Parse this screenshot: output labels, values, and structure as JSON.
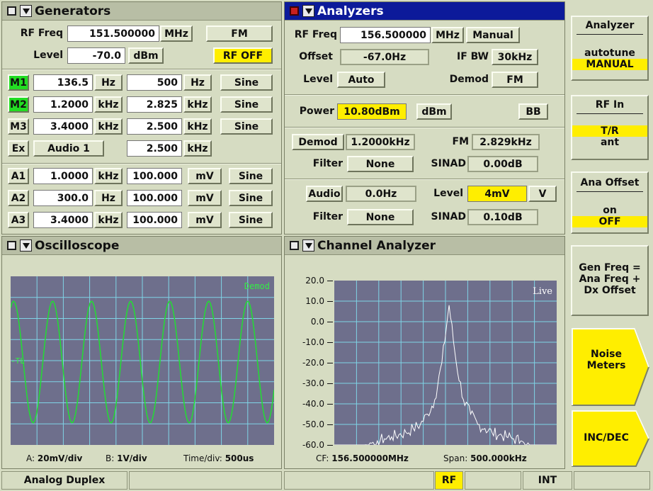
{
  "generators": {
    "title": "Generators",
    "rf_freq_label": "RF Freq",
    "rf_freq": "151.500000",
    "rf_freq_unit": "MHz",
    "mode": "FM",
    "level_label": "Level",
    "level": "-70.0",
    "level_unit": "dBm",
    "rf_state": "RF OFF",
    "mod_rows": [
      {
        "name": "M1",
        "freq": "136.5",
        "freq_unit": "Hz",
        "dev": "500",
        "dev_unit": "Hz",
        "wave": "Sine",
        "active": true
      },
      {
        "name": "M2",
        "freq": "1.2000",
        "freq_unit": "kHz",
        "dev": "2.825",
        "dev_unit": "kHz",
        "wave": "Sine",
        "active": true
      },
      {
        "name": "M3",
        "freq": "3.4000",
        "freq_unit": "kHz",
        "dev": "2.500",
        "dev_unit": "kHz",
        "wave": "Sine",
        "active": false
      }
    ],
    "ex": {
      "name": "Ex",
      "source": "Audio 1",
      "dev": "2.500",
      "dev_unit": "kHz"
    },
    "audio_rows": [
      {
        "name": "A1",
        "freq": "1.0000",
        "freq_unit": "kHz",
        "level": "100.000",
        "level_unit": "mV",
        "wave": "Sine"
      },
      {
        "name": "A2",
        "freq": "300.0",
        "freq_unit": "Hz",
        "level": "100.000",
        "level_unit": "mV",
        "wave": "Sine"
      },
      {
        "name": "A3",
        "freq": "3.4000",
        "freq_unit": "kHz",
        "level": "100.000",
        "level_unit": "mV",
        "wave": "Sine"
      }
    ]
  },
  "analyzers": {
    "title": "Analyzers",
    "rf_freq_label": "RF Freq",
    "rf_freq": "156.500000",
    "rf_freq_unit": "MHz",
    "tune": "Manual",
    "offset_label": "Offset",
    "offset": "-67.0Hz",
    "ifbw_label": "IF BW",
    "ifbw": "30kHz",
    "level_label": "Level",
    "level": "Auto",
    "demod_label": "Demod",
    "demod": "FM",
    "power_label": "Power",
    "power": "10.80dBm",
    "power_unit": "dBm",
    "bb": "BB",
    "demod_btn": "Demod",
    "demod_freq": "1.2000kHz",
    "fm_label": "FM",
    "fm_dev": "2.829kHz",
    "filter_label": "Filter",
    "filter1": "None",
    "sinad_label": "SINAD",
    "sinad1": "0.00dB",
    "audio_btn": "Audio",
    "audio_freq": "0.0Hz",
    "audio_level_label": "Level",
    "audio_level": "4mV",
    "audio_level_unit": "V",
    "filter2": "None",
    "sinad2": "0.10dB"
  },
  "oscilloscope": {
    "title": "Oscilloscope",
    "trace_label": "Demod",
    "marker": "-TL",
    "a_label": "A:",
    "a_val": "20mV/div",
    "b_label": "B:",
    "b_val": "1V/div",
    "t_label": "Time/div:",
    "t_val": "500us",
    "trace_color": "#22dd33"
  },
  "channel_analyzer": {
    "title": "Channel Analyzer",
    "live": "Live",
    "cf_label": "CF:",
    "cf": "156.500000MHz",
    "span_label": "Span:",
    "span": "500.000kHz"
  },
  "chart_data": {
    "type": "line",
    "title": "",
    "xlabel": "",
    "ylabel": "",
    "y_ticks": [
      "20.0",
      "10.0",
      "0.0",
      "-10.0",
      "-20.0",
      "-30.0",
      "-40.0",
      "-50.0",
      "-60.0"
    ],
    "ylim": [
      -60,
      20
    ],
    "center_freq": "156.500000MHz",
    "span": "500.000kHz",
    "series": [
      {
        "values": [
          -60,
          -60,
          -60,
          -60,
          -60,
          -59,
          -58,
          -57,
          -56,
          -55,
          -54,
          -52,
          -50,
          -45,
          -38,
          -20,
          8,
          -20,
          -38,
          -45,
          -50,
          -52,
          -54,
          -55,
          -56,
          -57,
          -58,
          -59,
          -60,
          -60,
          -60,
          -60
        ]
      }
    ],
    "grid": true
  },
  "softkeys": {
    "analyzer_title": "Analyzer",
    "autotune": "autotune",
    "manual": "MANUAL",
    "rfin_title": "RF In",
    "tr": "T/R",
    "ant": "ant",
    "anaoff_title": "Ana Offset",
    "on": "on",
    "off": "OFF",
    "genfreq": [
      "Gen Freq =",
      "Ana Freq +",
      "Dx Offset"
    ],
    "noise": [
      "Noise",
      "Meters"
    ],
    "incdec": "INC/DEC"
  },
  "status": {
    "mode": "Analog Duplex",
    "rf": "RF",
    "ref": "INT"
  },
  "colors": {
    "panel": "#d6dcc2",
    "highlight": "#ffee00",
    "active_title": "#0c1a9a",
    "screen": "#6e6f8c",
    "grid": "#7fd4e6"
  }
}
